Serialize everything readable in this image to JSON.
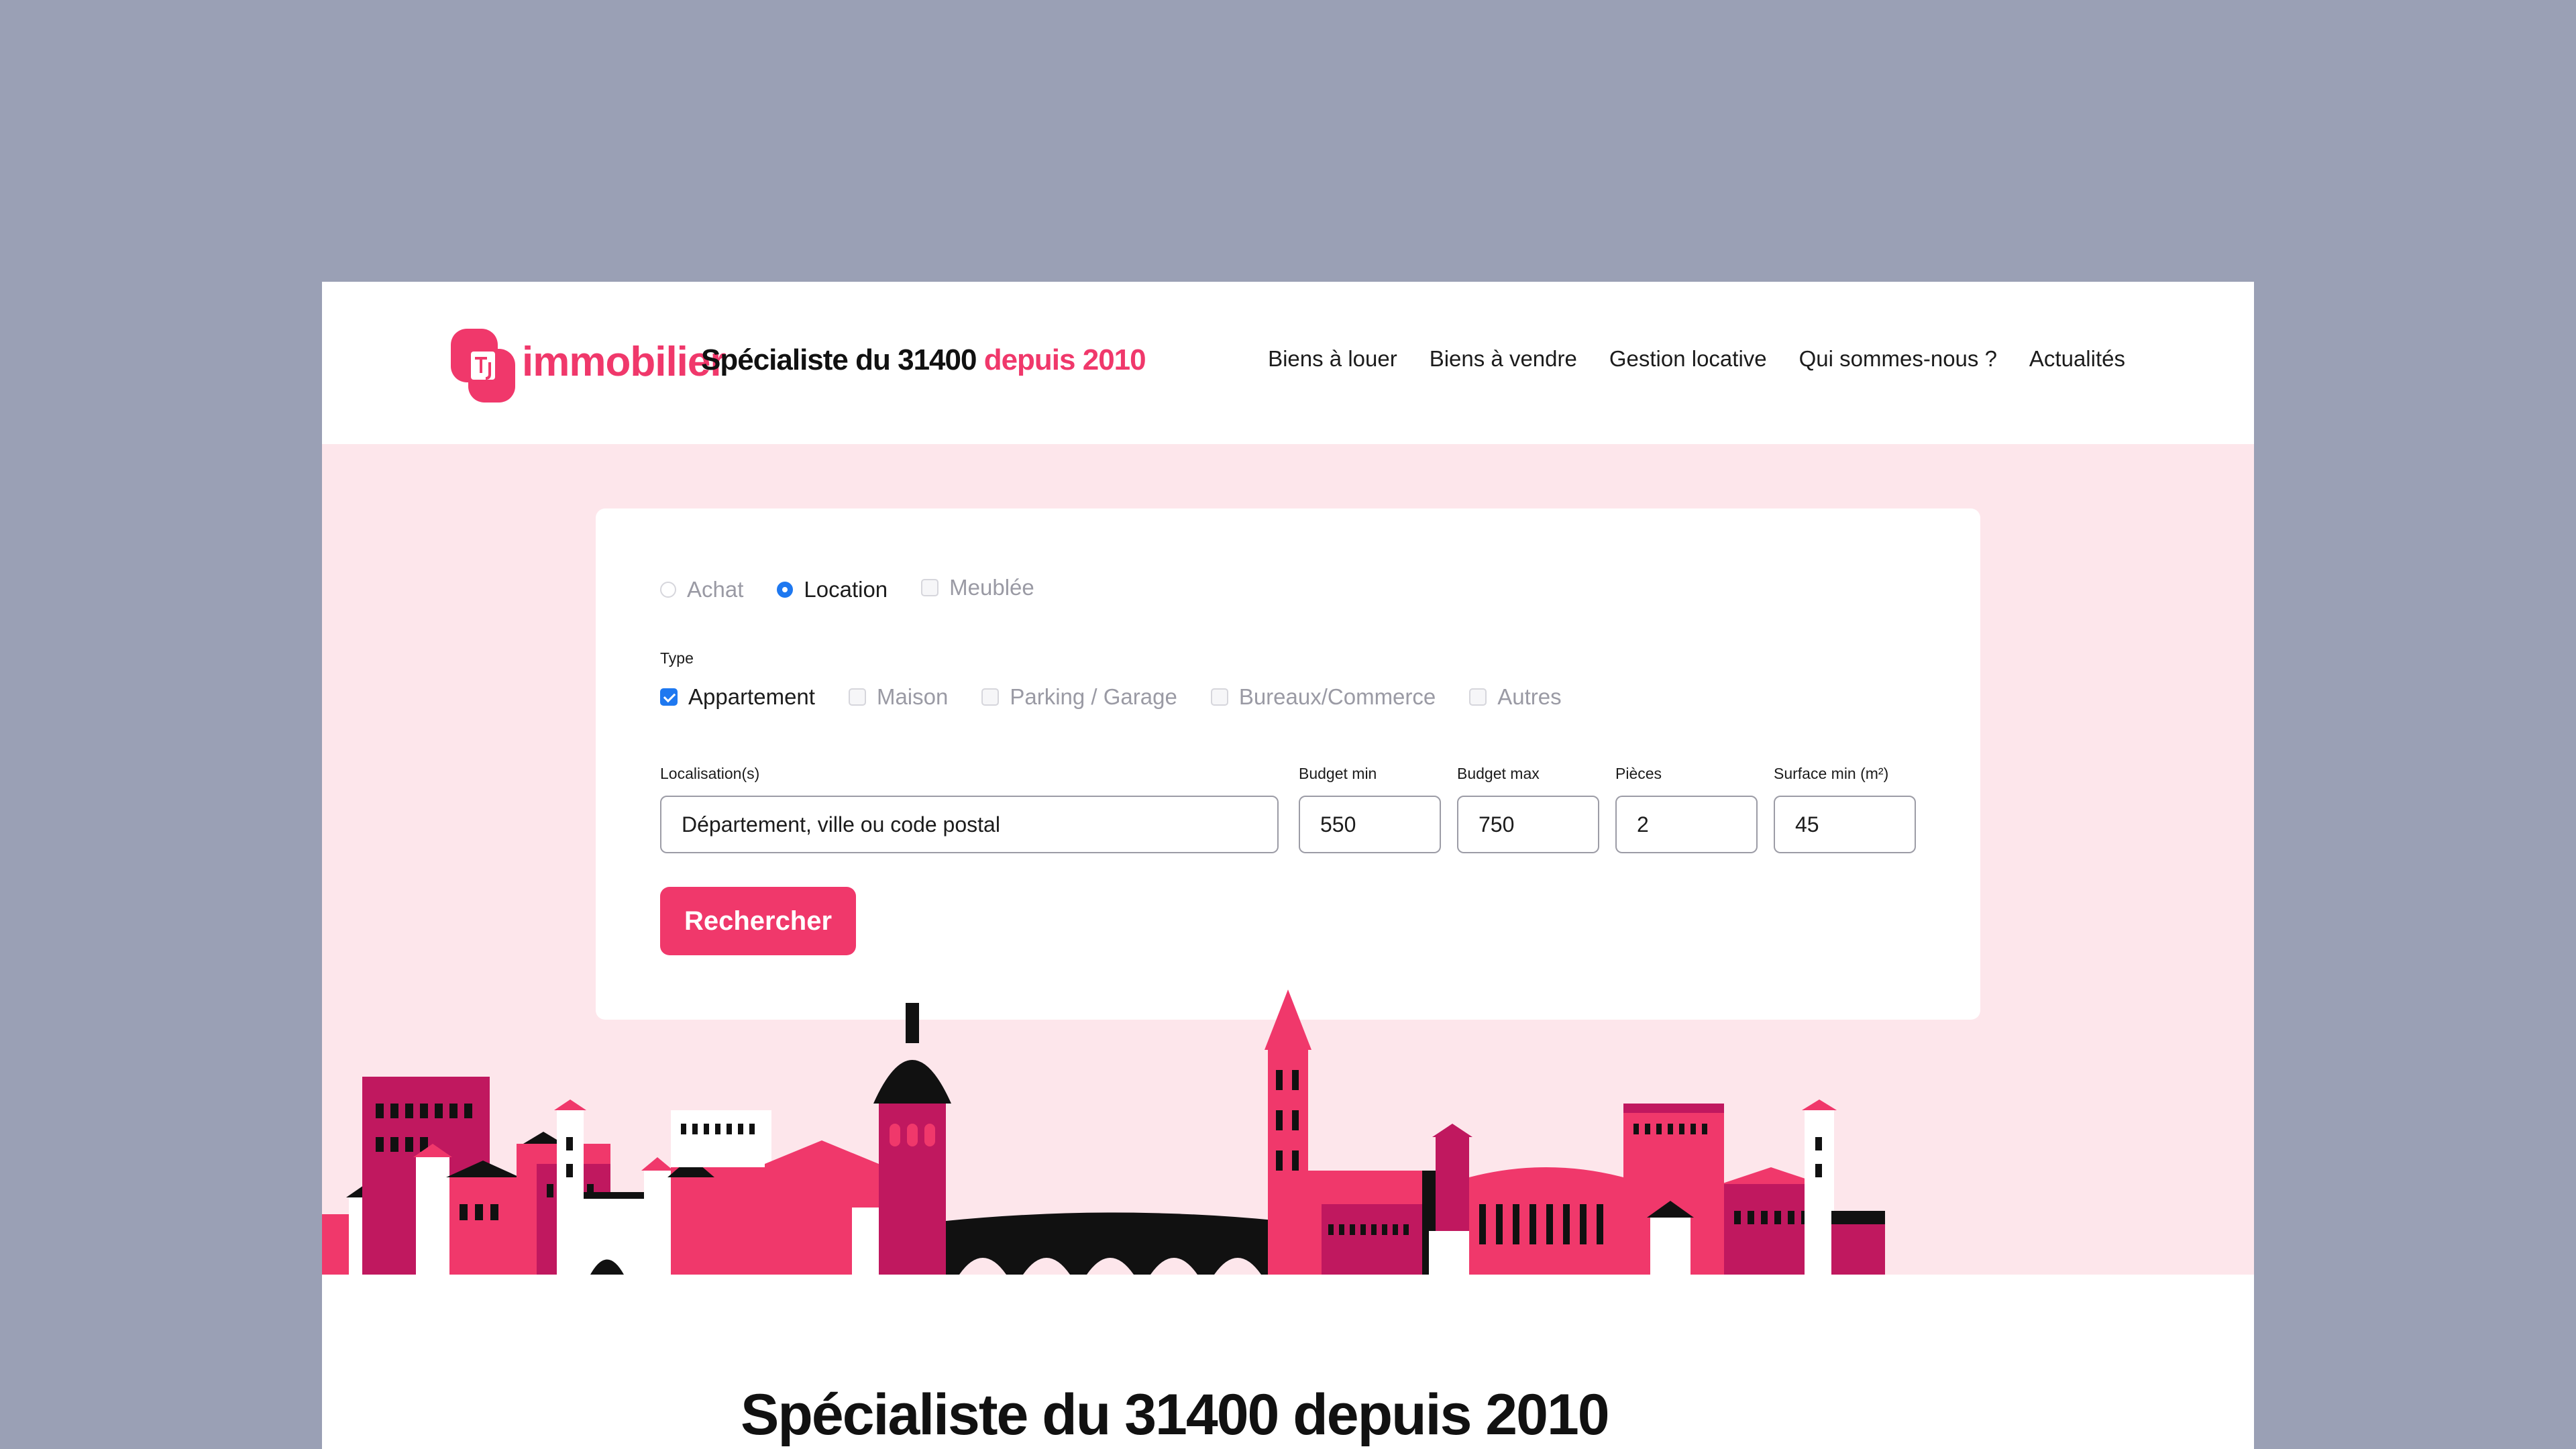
{
  "header": {
    "logo_text": "immobilier",
    "logo_mark_letters": "TJ",
    "tagline_main": "Spécialiste du 31400",
    "tagline_accent": "depuis 2010",
    "nav": [
      "Biens à louer",
      "Biens à vendre",
      "Gestion locative",
      "Qui sommes-nous ?",
      "Actualités"
    ]
  },
  "search": {
    "mode": {
      "achat": "Achat",
      "location": "Location",
      "meublee": "Meublée",
      "selected": "Location"
    },
    "type_label": "Type",
    "types": [
      {
        "label": "Appartement",
        "checked": true
      },
      {
        "label": "Maison",
        "checked": false
      },
      {
        "label": "Parking / Garage",
        "checked": false
      },
      {
        "label": "Bureaux/Commerce",
        "checked": false
      },
      {
        "label": "Autres",
        "checked": false
      }
    ],
    "location_label": "Localisation(s)",
    "location_value": "Département, ville ou code postal",
    "budget_min_label": "Budget min",
    "budget_min": "550",
    "budget_max_label": "Budget max",
    "budget_max": "750",
    "pieces_label": "Pièces",
    "pieces": "2",
    "surface_label": "Surface min (m²)",
    "surface": "45",
    "submit": "Rechercher"
  },
  "colors": {
    "accent": "#f0386b",
    "hero_bg": "#fde6eb",
    "check_blue": "#1e78f0",
    "outer_bg": "#9aa0b5"
  },
  "section_title": "Spécialiste du 31400 depuis 2010"
}
